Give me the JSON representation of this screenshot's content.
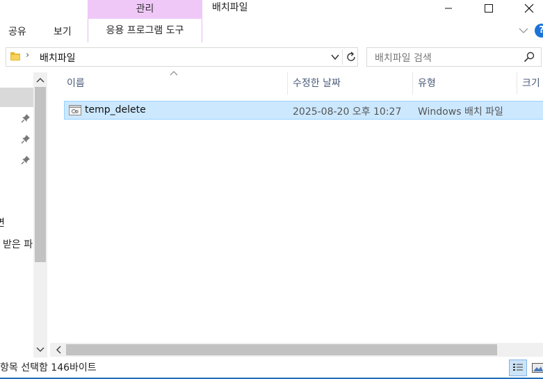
{
  "ribbon": {
    "manage_tab": "관리",
    "app_tools_tab": "응용 프로그램 도구",
    "share_tab": "공유",
    "view_tab": "보기",
    "help_label": "?"
  },
  "window": {
    "title": "배치파일"
  },
  "address": {
    "breadcrumb": "배치파일"
  },
  "search": {
    "placeholder": "배치파일 검색"
  },
  "nav": {
    "item_a": "면",
    "item_b": "받은 파"
  },
  "columns": {
    "name": "이름",
    "date": "수정한 날짜",
    "type": "유형",
    "size": "크기"
  },
  "files": [
    {
      "name": "temp_delete",
      "modified": "2025-08-20 오후 10:27",
      "type": "Windows 배치 파일"
    }
  ],
  "status": {
    "text": "항목 선택함 146바이트"
  },
  "colors": {
    "manage_tab_bg": "#f0c8f8",
    "selection_bg": "#cce8ff",
    "selection_border": "#99d1ff",
    "help_blue": "#1a73d6"
  }
}
